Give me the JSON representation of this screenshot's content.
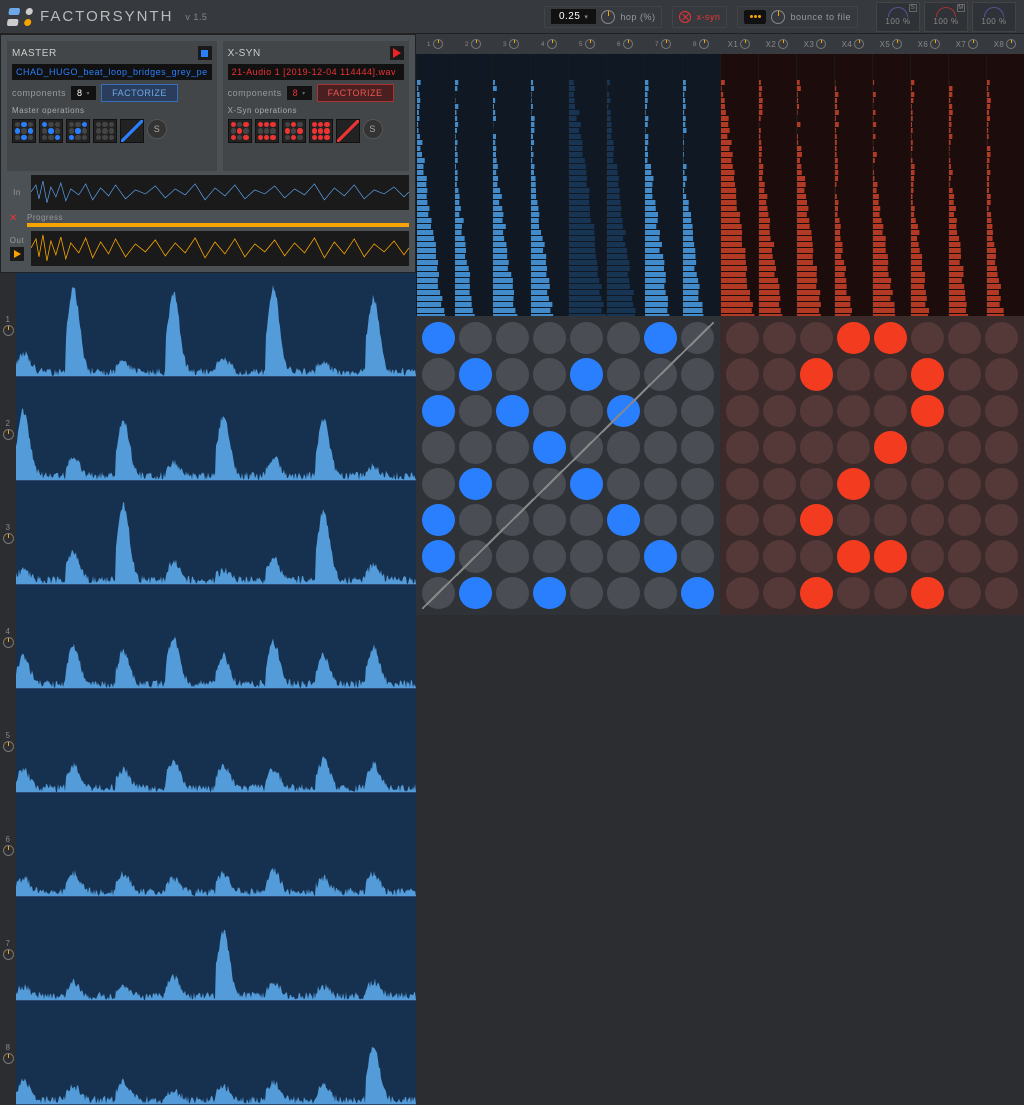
{
  "app": {
    "title": "FACTORSYNTH",
    "version": "v 1.5"
  },
  "topbar": {
    "hop_value": "0.25",
    "hop_label": "hop (%)",
    "xsyn_label": "x-syn",
    "bounce_label": "bounce to file",
    "meters": [
      {
        "pct": "100 %",
        "tag": "S"
      },
      {
        "pct": "100 %",
        "tag": "M"
      },
      {
        "pct": "100 %",
        "tag": ""
      }
    ]
  },
  "master": {
    "title": "MASTER",
    "file": "CHAD_HUGO_beat_loop_bridges_grey_pe",
    "components_label": "components",
    "components_value": "8",
    "factorize": "FACTORIZE",
    "ops_label": "Master operations",
    "s_label": "S"
  },
  "xsyn": {
    "title": "X-SYN",
    "file": "21-Audio 1 [2019-12-04 114444].wav",
    "components_label": "components",
    "components_value": "8",
    "factorize": "FACTORIZE",
    "ops_label": "X-Syn operations",
    "s_label": "S"
  },
  "waves": {
    "in": "In",
    "progress": "Progress",
    "out": "Out"
  },
  "components": {
    "count": 8,
    "labels": [
      "1",
      "2",
      "3",
      "4",
      "5",
      "6",
      "7",
      "8"
    ]
  },
  "spectral": {
    "blue_labels": [
      "1",
      "2",
      "3",
      "4",
      "5",
      "6",
      "7",
      "8"
    ],
    "red_labels": [
      "X1",
      "X2",
      "X3",
      "X4",
      "X5",
      "X6",
      "X7",
      "X8"
    ]
  },
  "matrix_blue": [
    [
      1,
      0,
      0,
      0,
      0,
      0,
      1,
      0
    ],
    [
      0,
      1,
      0,
      0,
      1,
      0,
      0,
      0
    ],
    [
      1,
      0,
      1,
      0,
      0,
      1,
      0,
      0
    ],
    [
      0,
      0,
      0,
      1,
      0,
      0,
      0,
      0
    ],
    [
      0,
      1,
      0,
      0,
      1,
      0,
      0,
      0
    ],
    [
      1,
      0,
      0,
      0,
      0,
      1,
      0,
      0
    ],
    [
      1,
      0,
      0,
      0,
      0,
      0,
      1,
      0
    ],
    [
      0,
      1,
      0,
      1,
      0,
      0,
      0,
      1
    ]
  ],
  "matrix_red": [
    [
      0,
      0,
      0,
      1,
      1,
      0,
      0,
      0
    ],
    [
      0,
      0,
      1,
      0,
      0,
      1,
      0,
      0
    ],
    [
      0,
      0,
      0,
      0,
      0,
      1,
      0,
      0
    ],
    [
      0,
      0,
      0,
      0,
      1,
      0,
      0,
      0
    ],
    [
      0,
      0,
      0,
      1,
      0,
      0,
      0,
      0
    ],
    [
      0,
      0,
      1,
      0,
      0,
      0,
      0,
      0
    ],
    [
      0,
      0,
      0,
      1,
      1,
      0,
      0,
      0
    ],
    [
      0,
      0,
      1,
      0,
      0,
      1,
      0,
      0
    ]
  ]
}
